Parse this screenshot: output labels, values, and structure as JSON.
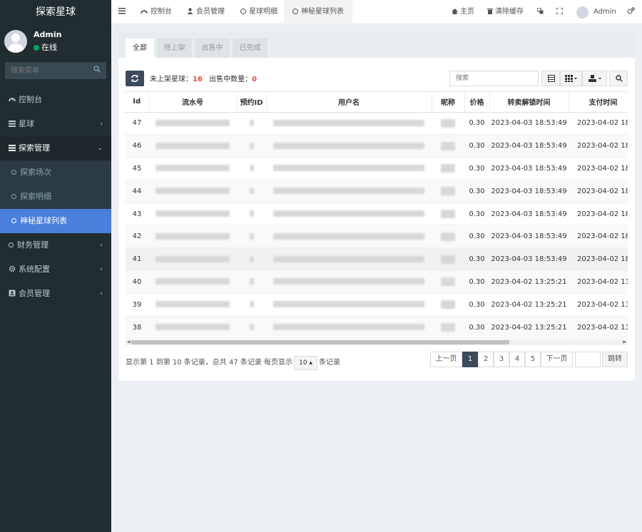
{
  "brand": "探索星球",
  "user": {
    "name": "Admin",
    "status": "在线"
  },
  "sidebar_search_placeholder": "搜索菜单",
  "menu": [
    {
      "label": "控制台",
      "icon": "dashboard-icon"
    },
    {
      "label": "星球",
      "icon": "list-icon"
    },
    {
      "label": "探索管理",
      "icon": "list-icon"
    },
    {
      "label": "探索场次"
    },
    {
      "label": "探索明细"
    },
    {
      "label": "神秘星球列表"
    },
    {
      "label": "财务管理"
    },
    {
      "label": "系统配置",
      "icon": "gear-icon"
    },
    {
      "label": "会员管理",
      "icon": "id-card-icon"
    }
  ],
  "topbar": {
    "tabs": [
      "控制台",
      "会员管理",
      "星球明细",
      "神秘星球列表"
    ],
    "home": "主页",
    "clear_cache": "清除缓存",
    "admin": "Admin"
  },
  "content_tabs": [
    "全部",
    "待上架",
    "出售中",
    "已完成"
  ],
  "counts": {
    "unlisted_label": "未上架星球：",
    "unlisted_value": "16",
    "selling_label": "出售中数量：",
    "selling_value": "0"
  },
  "table_search_placeholder": "搜索",
  "columns": [
    "Id",
    "流水号",
    "预约ID",
    "用户名",
    "昵称",
    "价格",
    "转卖解锁时间",
    "支付时间"
  ],
  "rows": [
    {
      "id": "47",
      "price": "0.30",
      "unlock": "2023-04-03 18:53:49",
      "paid": "2023-04-02 18:"
    },
    {
      "id": "46",
      "price": "0.30",
      "unlock": "2023-04-03 18:53:49",
      "paid": "2023-04-02 18:"
    },
    {
      "id": "45",
      "price": "0.30",
      "unlock": "2023-04-03 18:53:49",
      "paid": "2023-04-02 18:"
    },
    {
      "id": "44",
      "price": "0.30",
      "unlock": "2023-04-03 18:53:49",
      "paid": "2023-04-02 18:"
    },
    {
      "id": "43",
      "price": "0.30",
      "unlock": "2023-04-03 18:53:49",
      "paid": "2023-04-02 18:"
    },
    {
      "id": "42",
      "price": "0.30",
      "unlock": "2023-04-03 18:53:49",
      "paid": "2023-04-02 18:"
    },
    {
      "id": "41",
      "price": "0.30",
      "unlock": "2023-04-03 18:53:49",
      "paid": "2023-04-02 18:"
    },
    {
      "id": "40",
      "price": "0.30",
      "unlock": "2023-04-02 13:25:21",
      "paid": "2023-04-02 13:"
    },
    {
      "id": "39",
      "price": "0.30",
      "unlock": "2023-04-02 13:25:21",
      "paid": "2023-04-02 13:"
    },
    {
      "id": "38",
      "price": "0.30",
      "unlock": "2023-04-02 13:25:21",
      "paid": "2023-04-02 13:"
    }
  ],
  "pager": {
    "info_prefix": "显示第 1 到第 10 条记录，总共 47 条记录 每页显示",
    "page_size": "10 ▴",
    "info_suffix": "条记录",
    "prev": "上一页",
    "pages": [
      "1",
      "2",
      "3",
      "4",
      "5"
    ],
    "next": "下一页",
    "jump": "跳转"
  }
}
